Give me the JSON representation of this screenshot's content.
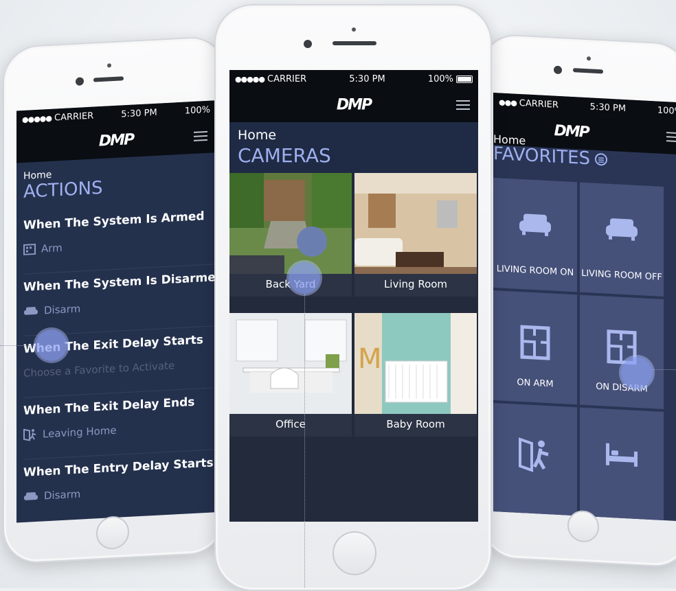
{
  "status": {
    "carrier": "CARRIER",
    "time": "5:30 PM",
    "battery": "100%"
  },
  "brand": {
    "logo": "DMP",
    "accent": "#9fb0f0",
    "header_bg": "#0a0d12",
    "screen_bg": "#1f2a44"
  },
  "cameras_screen": {
    "breadcrumb": "Home",
    "title": "CAMERAS",
    "tiles": [
      {
        "label": "Back Yard"
      },
      {
        "label": "Living Room"
      },
      {
        "label": "Office"
      },
      {
        "label": "Baby Room"
      }
    ]
  },
  "actions_screen": {
    "breadcrumb": "Home",
    "title": "ACTIONS",
    "items": [
      {
        "title": "When The System Is Armed",
        "action": "Arm",
        "icon": "keypad-icon"
      },
      {
        "title": "When The System Is Disarmed",
        "action": "Disarm",
        "icon": "sofa-icon"
      },
      {
        "title": "When The Exit Delay Starts",
        "action": "Choose a Favorite to Activate",
        "icon": ""
      },
      {
        "title": "When The Exit Delay Ends",
        "action": "Leaving Home",
        "icon": "leaving-home-icon"
      },
      {
        "title": "When The Entry Delay Starts",
        "action": "Disarm",
        "icon": "sofa-icon"
      }
    ]
  },
  "favorites_screen": {
    "breadcrumb": "Home",
    "title": "FAVORITES",
    "tiles": [
      {
        "label": "LIVING ROOM ON",
        "icon": "sofa-icon"
      },
      {
        "label": "LIVING ROOM OFF",
        "icon": "sofa-icon"
      },
      {
        "label": "ON ARM",
        "icon": "floorplan-icon"
      },
      {
        "label": "ON DISARM",
        "icon": "floorplan-icon"
      },
      {
        "label": "",
        "icon": "leaving-home-icon"
      },
      {
        "label": "",
        "icon": "bed-icon"
      }
    ]
  }
}
